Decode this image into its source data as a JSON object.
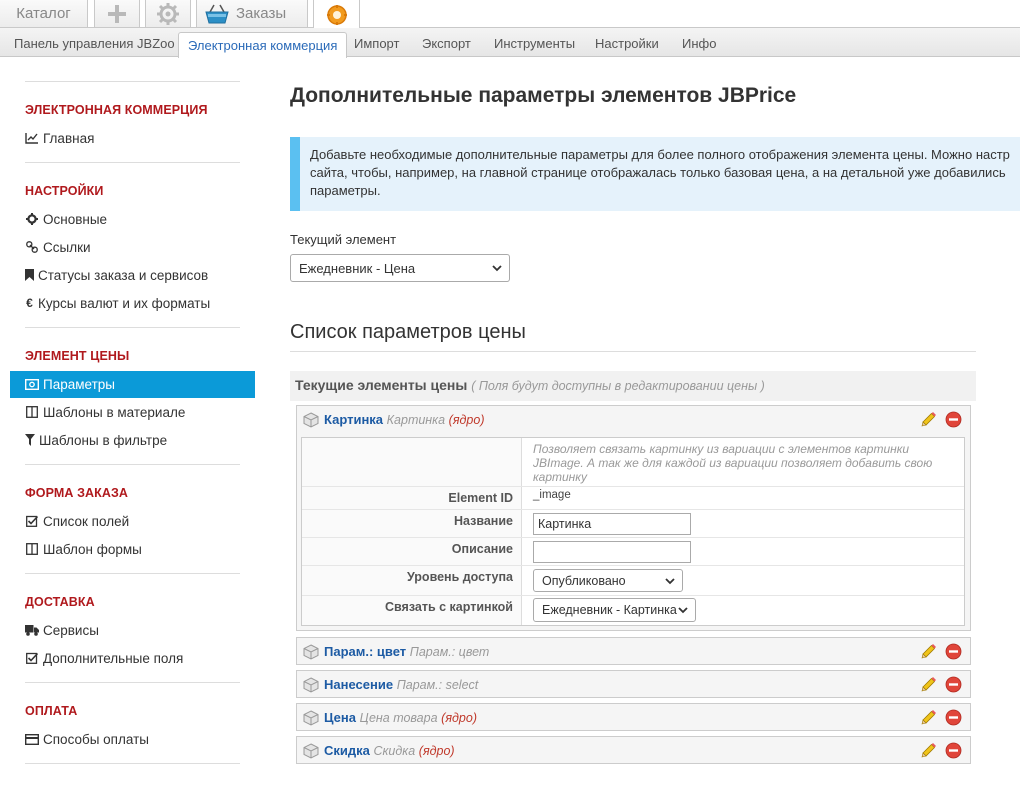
{
  "top_tabs": [
    {
      "label": "Каталог"
    },
    {
      "label": ""
    },
    {
      "label": ""
    },
    {
      "label": "Заказы"
    },
    {
      "label": ""
    }
  ],
  "submenu": [
    {
      "label": "Панель управления JBZoo"
    },
    {
      "label": "Электронная коммерция",
      "active": true
    },
    {
      "label": "Импорт"
    },
    {
      "label": "Экспорт"
    },
    {
      "label": "Инструменты"
    },
    {
      "label": "Настройки"
    },
    {
      "label": "Инфо"
    }
  ],
  "sidebar": {
    "sections": [
      {
        "title": "ЭЛЕКТРОННАЯ КОММЕРЦИЯ",
        "items": [
          {
            "label": "Главная",
            "icon": "chart-line-icon"
          }
        ]
      },
      {
        "title": "НАСТРОЙКИ",
        "items": [
          {
            "label": "Основные",
            "icon": "gear-icon"
          },
          {
            "label": "Ссылки",
            "icon": "link-icon"
          },
          {
            "label": "Статусы заказа и сервисов",
            "icon": "bookmark-icon"
          },
          {
            "label": "Курсы валют и их форматы",
            "icon": "euro-icon"
          }
        ]
      },
      {
        "title": "ЭЛЕМЕНТ ЦЕНЫ",
        "items": [
          {
            "label": "Параметры",
            "icon": "money-icon",
            "active": true
          },
          {
            "label": "Шаблоны в материале",
            "icon": "columns-icon"
          },
          {
            "label": "Шаблоны в фильтре",
            "icon": "filter-icon"
          }
        ]
      },
      {
        "title": "ФОРМА ЗАКАЗА",
        "items": [
          {
            "label": "Список полей",
            "icon": "check-square-icon"
          },
          {
            "label": "Шаблон формы",
            "icon": "columns-icon"
          }
        ]
      },
      {
        "title": "ДОСТАВКА",
        "items": [
          {
            "label": "Сервисы",
            "icon": "truck-icon"
          },
          {
            "label": "Дополнительные поля",
            "icon": "check-square-icon"
          }
        ]
      },
      {
        "title": "ОПЛАТА",
        "items": [
          {
            "label": "Способы оплаты",
            "icon": "credit-card-icon"
          }
        ]
      }
    ]
  },
  "main": {
    "title": "Дополнительные параметры элементов JBPrice",
    "info_line1": "Добавьте необходимые дополнительные параметры для более полного отображения элемента цены. Можно настр",
    "info_line2": "сайта, чтобы, например, на главной странице отображалась только базовая цена, а на детальной уже добавились",
    "info_line3": "параметры.",
    "current_element_label": "Текущий элемент",
    "current_element_value": "Ежедневник - Цена",
    "list_title": "Список параметров цены",
    "current_bar_title": "Текущие элементы цены",
    "current_bar_sub": "( Поля будут доступны в редактировании цены )",
    "elements": [
      {
        "name": "Картинка",
        "type": "Картинка",
        "core": "(ядро)"
      },
      {
        "name": "Парам.: цвет",
        "type": "Парам.: цвет",
        "core": ""
      },
      {
        "name": "Нанесение",
        "type": "Парам.: select",
        "core": ""
      },
      {
        "name": "Цена",
        "type": "Цена товара",
        "core": "(ядро)"
      },
      {
        "name": "Скидка",
        "type": "Скидка",
        "core": "(ядро)"
      }
    ],
    "expanded": {
      "description": "Позволяет связать картинку из вариации с элементов картинки JBImage. А так же для каждой из вариации позволяет добавить свою картинку",
      "element_id_label": "Element ID",
      "element_id_value": "_image",
      "name_label": "Название",
      "name_value": "Картинка",
      "desc_label": "Описание",
      "desc_value": "",
      "access_label": "Уровень доступа",
      "access_value": "Опубликовано",
      "link_label": "Связать с картинкой",
      "link_value": "Ежедневник - Картинка"
    }
  },
  "colors": {
    "accent": "#0b9ad8",
    "section_heading": "#b0191d",
    "link": "#1d5ba4",
    "info_bg": "#e5f2fb",
    "info_border": "#5bc0f1"
  }
}
